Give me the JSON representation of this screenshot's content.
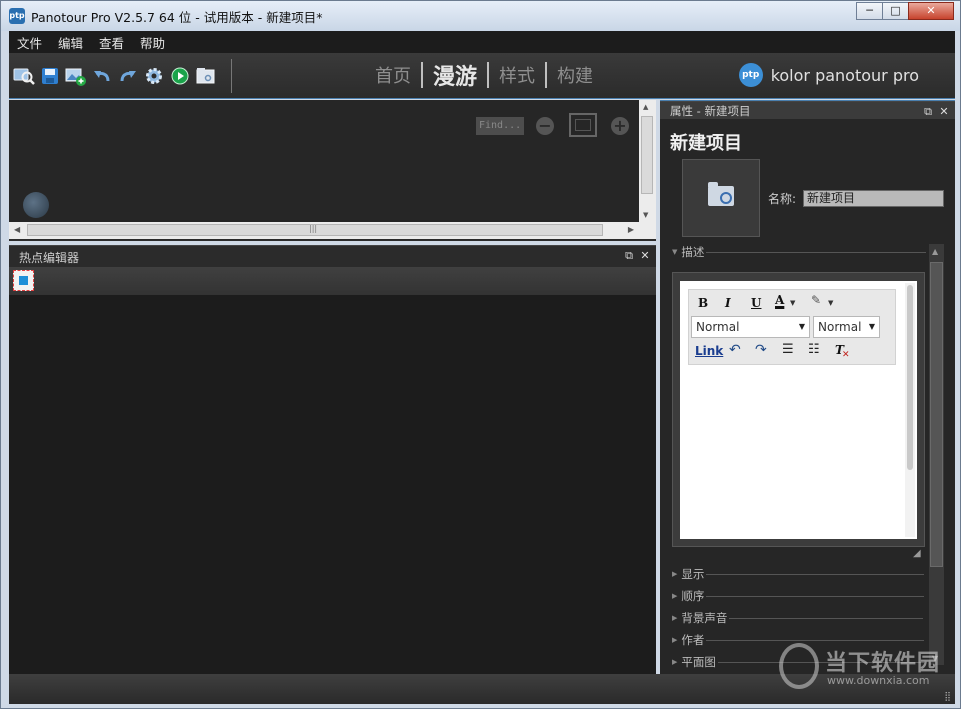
{
  "window": {
    "title": "Panotour Pro V2.5.7 64 位 - 试用版本 - 新建项目*",
    "app_icon": "ptp",
    "controls": {
      "minimize": "─",
      "maximize": "□",
      "close": "✕"
    }
  },
  "menu": [
    "文件",
    "编辑",
    "查看",
    "帮助"
  ],
  "toolbar": {
    "icons": [
      "search-panorama-icon",
      "save-icon",
      "add-panorama-icon",
      "undo-icon",
      "redo-icon",
      "settings-icon",
      "play-icon",
      "export-icon"
    ],
    "tabs": [
      "首页",
      "漫游",
      "样式",
      "构建"
    ],
    "active_tab": "漫游",
    "brand_logo": "ptp",
    "brand": "kolor panotour pro"
  },
  "viewer": {
    "find_placeholder": "Find...",
    "zoom_out": "−",
    "zoom_in": "+"
  },
  "hotspot_editor": {
    "title": "热点编辑器"
  },
  "properties": {
    "header": "属性 - 新建项目",
    "project_title": "新建项目",
    "name_label": "名称:",
    "name_value": "新建项目",
    "description_label": "描述",
    "editor": {
      "bold": "B",
      "italic": "I",
      "underline": "U",
      "font_color": "A",
      "format_select": "Normal",
      "size_select": "Normal",
      "link": "Link",
      "clear_format": "T"
    },
    "sections": [
      "显示",
      "顺序",
      "背景声音",
      "作者",
      "平面图"
    ]
  },
  "watermark": {
    "text": "当下软件园",
    "url": "www.downxia.com"
  },
  "colors": {
    "accent": "#4a7fae",
    "panel_bg": "#262626",
    "play_green": "#1aa34a"
  }
}
